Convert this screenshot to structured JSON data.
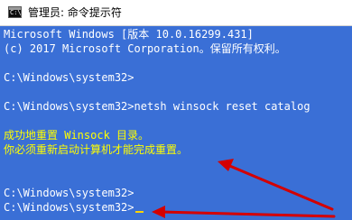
{
  "window": {
    "title": "管理员: 命令提示符",
    "icon": "cmd-icon",
    "icon_prompt": "C:\\"
  },
  "console": {
    "lines": [
      "Microsoft Windows [版本 10.0.16299.431]",
      "(c) 2017 Microsoft Corporation。保留所有权利。",
      "",
      "C:\\Windows\\system32>",
      "",
      "C:\\Windows\\system32>netsh winsock reset catalog",
      "",
      "成功地重置 Winsock 目录。",
      "你必须重新启动计算机才能完成重置。",
      "",
      "",
      "C:\\Windows\\system32>",
      "C:\\Windows\\system32>"
    ],
    "highlighted_lines": [
      7,
      8
    ]
  },
  "colors": {
    "console_bg": "#3a6fd6",
    "console_text": "#ffffff",
    "highlight_text": "#ffff00",
    "cursor": "#ffd400",
    "annotation_arrow": "#d40000"
  }
}
